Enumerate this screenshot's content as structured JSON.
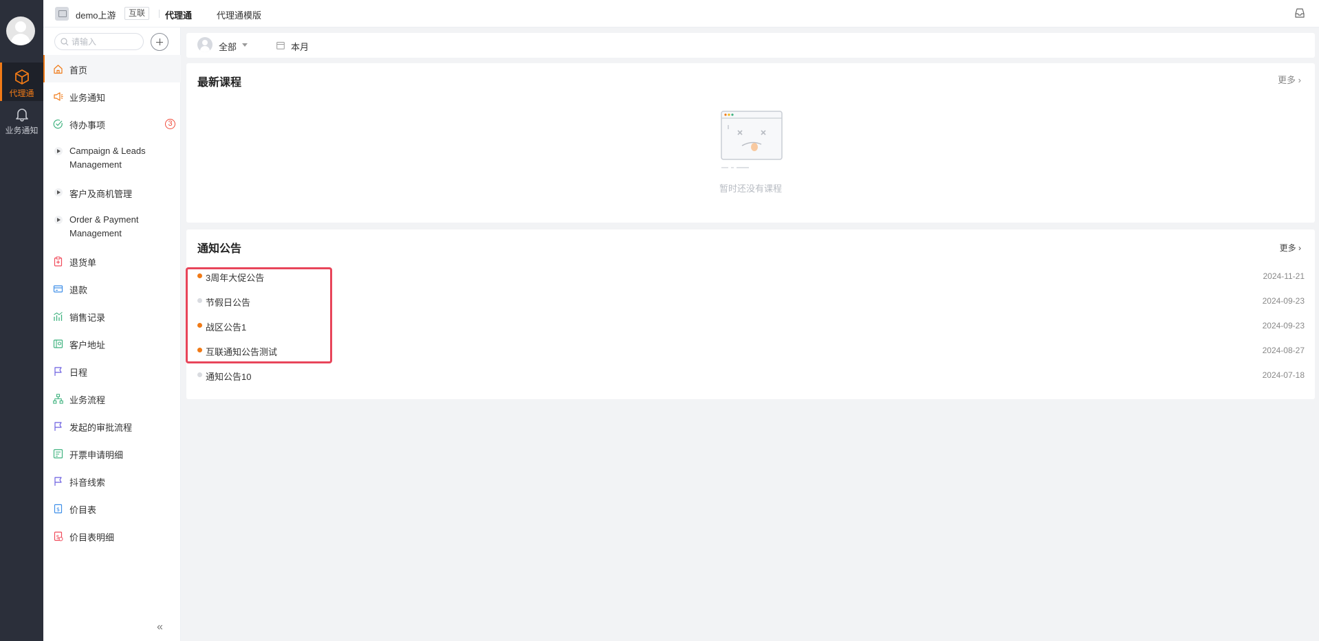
{
  "rail": {
    "items": [
      {
        "label": "代理通",
        "icon": "cube-icon"
      },
      {
        "label": "业务通知",
        "icon": "bell-icon"
      }
    ]
  },
  "topbar": {
    "brand_name": "demo上游",
    "brand_tag": "互联",
    "tabs": [
      {
        "label": "代理通"
      },
      {
        "label": "代理通模版"
      }
    ]
  },
  "sidebar": {
    "search_placeholder": "请输入",
    "items": [
      {
        "label": "首页",
        "icon": "home-icon"
      },
      {
        "label": "业务通知",
        "icon": "megaphone-icon"
      },
      {
        "label": "待办事项",
        "icon": "check-circle-icon",
        "badge": "3"
      },
      {
        "label": "Campaign & Leads Management"
      },
      {
        "label": "客户及商机管理"
      },
      {
        "label": "Order & Payment Management"
      },
      {
        "label": "退货单",
        "icon": "clipboard-icon"
      },
      {
        "label": "退款",
        "icon": "card-icon"
      },
      {
        "label": "销售记录",
        "icon": "chart-icon"
      },
      {
        "label": "客户地址",
        "icon": "address-icon"
      },
      {
        "label": "日程",
        "icon": "flag-icon"
      },
      {
        "label": "业务流程",
        "icon": "flow-icon"
      },
      {
        "label": "发起的审批流程",
        "icon": "flag-icon"
      },
      {
        "label": "开票申请明细",
        "icon": "invoice-icon"
      },
      {
        "label": "抖音线索",
        "icon": "flag-icon"
      },
      {
        "label": "价目表",
        "icon": "price-icon"
      },
      {
        "label": "价目表明细",
        "icon": "price-detail-icon"
      }
    ],
    "collapse_label": "«"
  },
  "filter": {
    "owner": "全部",
    "period": "本月"
  },
  "courses": {
    "title": "最新课程",
    "more": "更多",
    "empty_text": "暂时还没有课程"
  },
  "notices": {
    "title": "通知公告",
    "more": "更多",
    "items": [
      {
        "title": "3周年大促公告",
        "date": "2024-11-21",
        "unread": true
      },
      {
        "title": "节假日公告",
        "date": "2024-09-23",
        "unread": false
      },
      {
        "title": "战区公告1",
        "date": "2024-09-23",
        "unread": true
      },
      {
        "title": "互联通知公告测试",
        "date": "2024-08-27",
        "unread": true
      },
      {
        "title": "通知公告10",
        "date": "2024-07-18",
        "unread": false
      }
    ]
  },
  "colors": {
    "accent": "#f07a17",
    "rail_bg": "#2b2f3a",
    "unread_dot": "#f07a17",
    "read_dot": "#d9dbe0",
    "highlight_border": "#e8455a"
  }
}
